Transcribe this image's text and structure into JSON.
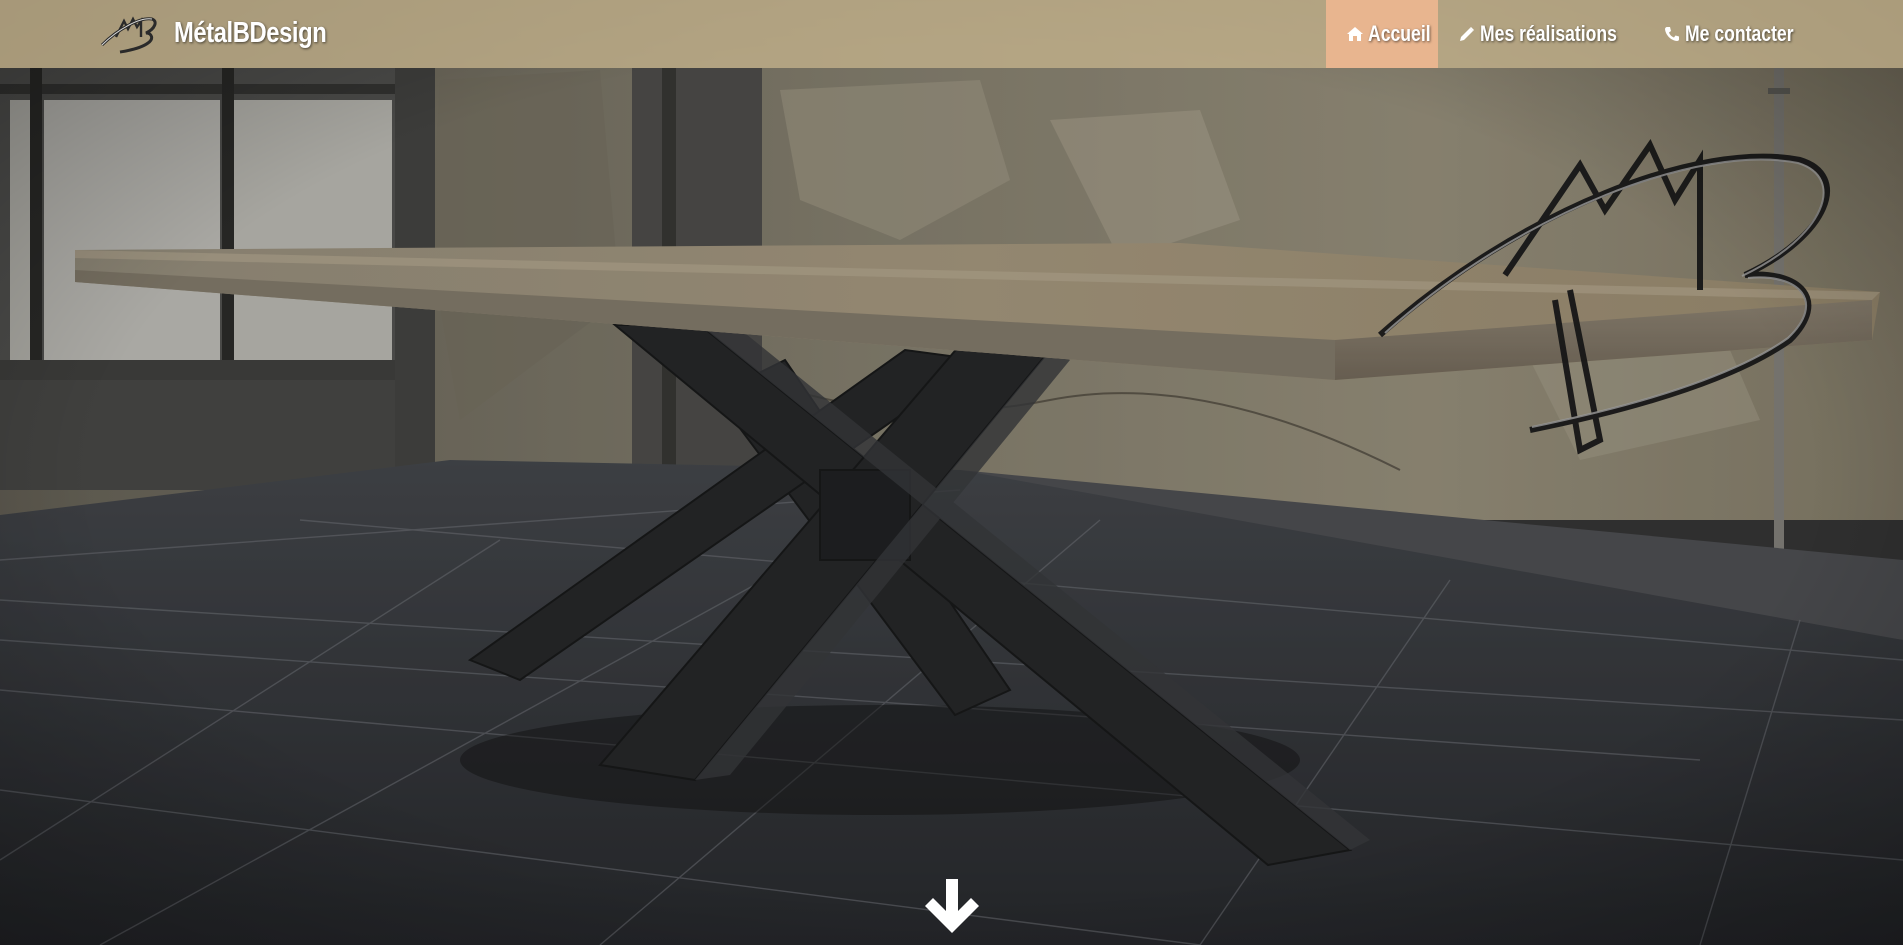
{
  "brand": {
    "name": "MétalBDesign",
    "logo_icon": "mb-monogram-logo"
  },
  "nav": {
    "items": [
      {
        "label": "Accueil",
        "icon": "home-icon",
        "active": true
      },
      {
        "label": "Mes réalisations",
        "icon": "pencil-icon",
        "active": false
      },
      {
        "label": "Me contacter",
        "icon": "phone-icon",
        "active": false
      }
    ]
  },
  "hero": {
    "image": "oak-slab-table-on-steel-x-base",
    "scroll_icon": "arrow-down-icon"
  },
  "colors": {
    "navbar_bg": "#c4b28c",
    "nav_active_bg": "#e8b58f",
    "nav_text": "#ffffff"
  }
}
